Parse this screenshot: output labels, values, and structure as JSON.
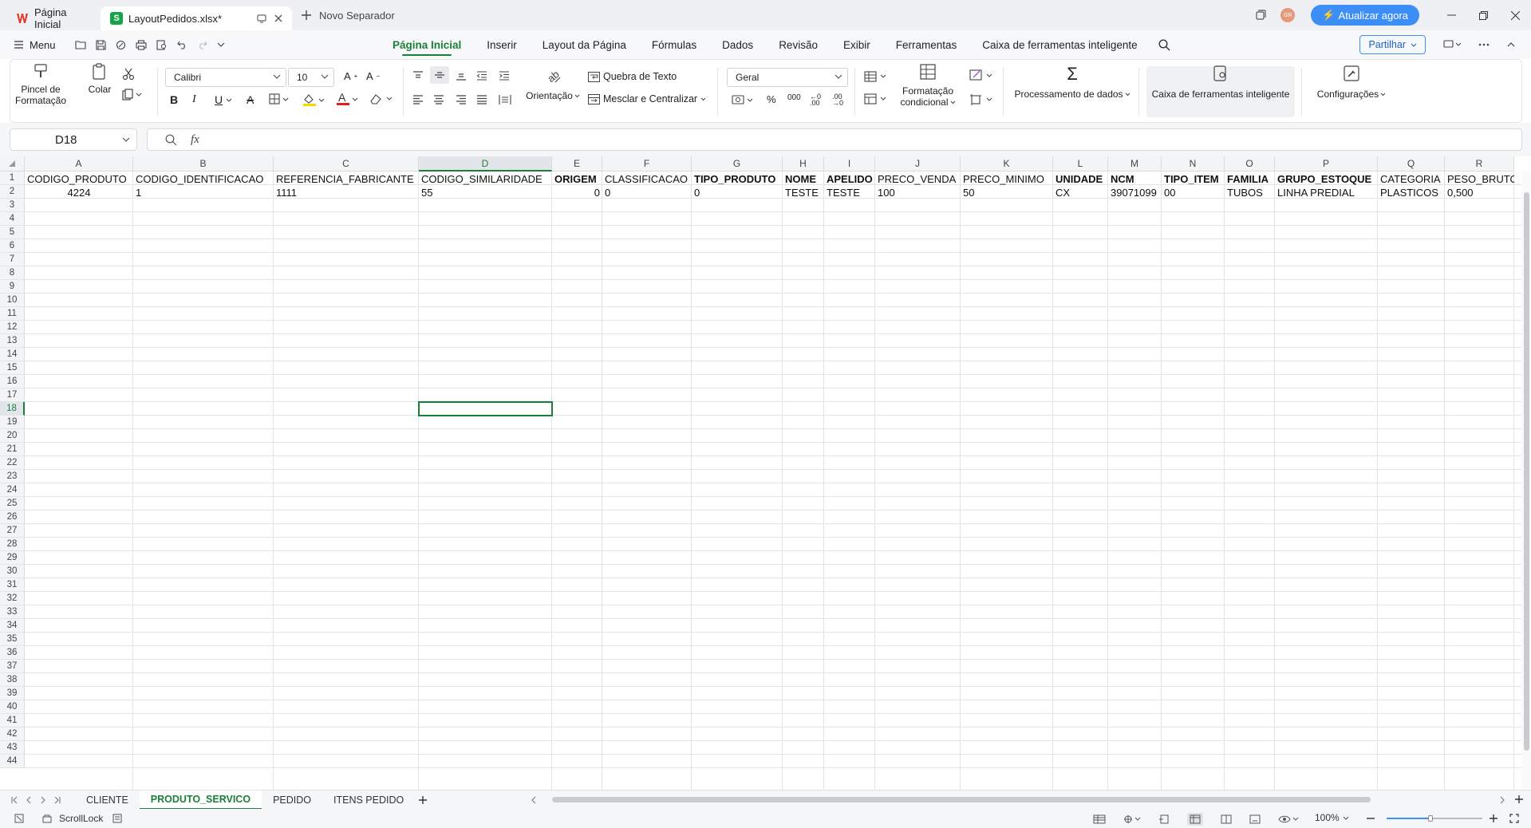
{
  "titlebar": {
    "home_tab": "Página Inicial",
    "file_tab": "LayoutPedidos.xlsx*",
    "new_tab": "Novo Separador",
    "avatar": "GR",
    "upgrade": "Atualizar agora"
  },
  "menu": {
    "menu_label": "Menu",
    "tabs": [
      "Página Inicial",
      "Inserir",
      "Layout da Página",
      "Fórmulas",
      "Dados",
      "Revisão",
      "Exibir",
      "Ferramentas",
      "Caixa de ferramentas inteligente"
    ],
    "active_tab": "Página Inicial",
    "share": "Partilhar"
  },
  "ribbon": {
    "format_painter": [
      "Pincel de",
      "Formatação"
    ],
    "paste": "Colar",
    "font": "Calibri",
    "font_size": "10",
    "wrap_text": "Quebra de Texto",
    "merge_center": "Mesclar e Centralizar",
    "orientation": "Orientação",
    "number_format": "Geral",
    "conditional_format": [
      "Formatação",
      "condicional"
    ],
    "data_processing": "Processamento de dados",
    "smart_toolbox": "Caixa de ferramentas inteligente",
    "settings": "Configurações"
  },
  "formula_bar": {
    "name_box": "D18",
    "fx": "fx",
    "content": ""
  },
  "sheet": {
    "columns": [
      "A",
      "B",
      "C",
      "D",
      "E",
      "F",
      "G",
      "H",
      "I",
      "J",
      "K",
      "L",
      "M",
      "N",
      "O",
      "P",
      "Q",
      "R"
    ],
    "selected_column": "D",
    "selected_row": 18,
    "rows": [
      "1",
      "2",
      "3",
      "4",
      "5",
      "6",
      "7",
      "8",
      "9",
      "10",
      "11",
      "12",
      "13",
      "14",
      "15",
      "16",
      "17",
      "18",
      "19",
      "20",
      "21",
      "22",
      "23",
      "24",
      "25",
      "26",
      "27",
      "28",
      "29",
      "30",
      "31",
      "32",
      "33",
      "34",
      "35",
      "36",
      "37",
      "38",
      "39",
      "40",
      "41",
      "42",
      "43",
      "44"
    ],
    "header_row": [
      "CODIGO_PRODUTO",
      "CODIGO_IDENTIFICACAO",
      "REFERENCIA_FABRICANTE",
      "CODIGO_SIMILARIDADE",
      "ORIGEM",
      "CLASSIFICACAO",
      "TIPO_PRODUTO",
      "NOME",
      "APELIDO",
      "PRECO_VENDA",
      "PRECO_MINIMO",
      "UNIDADE",
      "NCM",
      "TIPO_ITEM",
      "FAMILIA",
      "GRUPO_ESTOQUE",
      "CATEGORIA",
      "PESO_BRUTO"
    ],
    "data_row": [
      "4224",
      "1",
      "1111",
      "55",
      "0",
      "0",
      "0",
      "TESTE",
      "TESTE",
      "100",
      "50",
      "CX",
      "39071099",
      "00",
      "TUBOS",
      "LINHA PREDIAL",
      "PLASTICOS",
      "0,500"
    ]
  },
  "sheet_tabs": [
    "CLIENTE",
    "PRODUTO_SERVICO",
    "PEDIDO",
    "ITENS PEDIDO"
  ],
  "active_sheet": "PRODUTO_SERVICO",
  "status": {
    "scroll_lock": "ScrollLock",
    "zoom": "100%"
  },
  "colors": {
    "accent": "#1a7f37",
    "brand_blue": "#3d8ef6"
  }
}
